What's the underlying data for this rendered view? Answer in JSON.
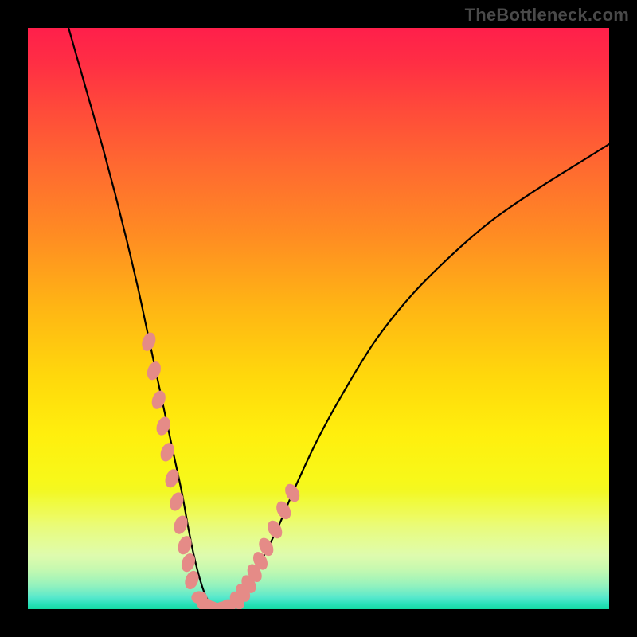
{
  "watermark": "TheBottleneck.com",
  "chart_data": {
    "type": "line",
    "title": "",
    "xlabel": "",
    "ylabel": "",
    "xlim": [
      0,
      100
    ],
    "ylim": [
      0,
      100
    ],
    "curve": {
      "x": [
        7.0,
        9.0,
        11.0,
        13.0,
        15.0,
        17.0,
        19.0,
        20.5,
        22.0,
        23.5,
        25.0,
        26.5,
        27.5,
        28.5,
        29.5,
        30.5,
        31.5,
        33.0,
        34.5,
        36.0,
        38.0,
        40.0,
        43.0,
        46.0,
        50.0,
        55.0,
        60.0,
        66.0,
        73.0,
        80.0,
        88.0,
        96.0,
        100.0
      ],
      "y": [
        100.0,
        93.0,
        86.0,
        79.0,
        71.5,
        63.5,
        55.0,
        48.0,
        41.0,
        34.0,
        27.0,
        20.0,
        14.5,
        9.5,
        5.5,
        2.5,
        0.8,
        0.0,
        0.3,
        1.5,
        4.0,
        8.0,
        14.0,
        21.0,
        29.5,
        38.5,
        46.5,
        54.0,
        61.0,
        67.0,
        72.5,
        77.5,
        80.0
      ]
    },
    "dots_left": {
      "x": [
        20.8,
        21.7,
        22.5,
        23.3,
        24.0,
        24.8,
        25.6,
        26.3,
        27.0,
        27.6,
        28.2
      ],
      "y": [
        46.0,
        41.0,
        36.0,
        31.5,
        27.0,
        22.5,
        18.5,
        14.5,
        11.0,
        8.0,
        5.0
      ]
    },
    "dots_right": {
      "x": [
        36.0,
        37.0,
        38.0,
        39.0,
        40.0,
        41.0,
        42.5,
        44.0,
        45.5
      ],
      "y": [
        1.5,
        2.8,
        4.3,
        6.2,
        8.3,
        10.7,
        13.7,
        17.0,
        20.0
      ]
    },
    "dots_bottom": {
      "x": [
        29.5,
        30.5,
        31.5,
        32.5,
        33.5,
        34.5
      ],
      "y": [
        2.0,
        0.8,
        0.3,
        0.0,
        0.2,
        0.6
      ]
    },
    "colors": {
      "curve": "#000000",
      "dots": "#e58b87",
      "background_top": "#ff1f4b",
      "background_bottom": "#13d9a2",
      "frame": "#000000",
      "watermark": "#4a4a4a"
    }
  }
}
